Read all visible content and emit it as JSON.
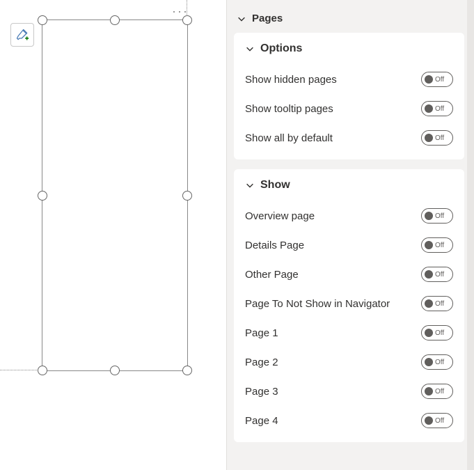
{
  "canvas": {
    "ellipsis": "···"
  },
  "panel": {
    "section": {
      "title": "Pages"
    },
    "options": {
      "title": "Options",
      "rows": [
        {
          "label": "Show hidden pages",
          "state": "Off"
        },
        {
          "label": "Show tooltip pages",
          "state": "Off"
        },
        {
          "label": "Show all by default",
          "state": "Off"
        }
      ]
    },
    "show": {
      "title": "Show",
      "rows": [
        {
          "label": "Overview page",
          "state": "Off"
        },
        {
          "label": "Details Page",
          "state": "Off"
        },
        {
          "label": "Other Page",
          "state": "Off"
        },
        {
          "label": "Page To Not Show in Navigator",
          "state": "Off"
        },
        {
          "label": "Page 1",
          "state": "Off"
        },
        {
          "label": "Page 2",
          "state": "Off"
        },
        {
          "label": "Page 3",
          "state": "Off"
        },
        {
          "label": "Page 4",
          "state": "Off"
        }
      ]
    }
  }
}
